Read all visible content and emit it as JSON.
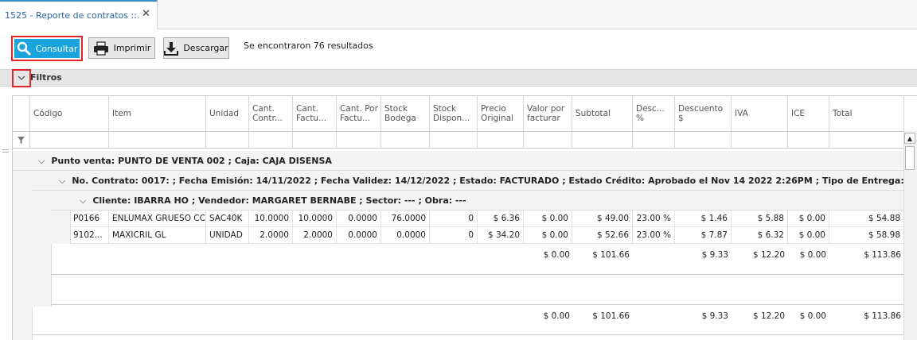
{
  "tab": {
    "title": "1525 - Reporte de contratos ::.",
    "close": "✕"
  },
  "toolbar": {
    "consultar": "Consultar",
    "imprimir": "Imprimir",
    "descargar": "Descargar",
    "results": "Se encontraron 76 resultados",
    "accent": "#1aa3dc",
    "highlight": "#e0252c"
  },
  "filtros": {
    "label": "Filtros"
  },
  "grid": {
    "columns": [
      {
        "label": "Código"
      },
      {
        "label": "Item"
      },
      {
        "label": "Unidad"
      },
      {
        "label": "Cant. Contr..."
      },
      {
        "label": "Cant. Factu..."
      },
      {
        "label": "Cant. Por Factu..."
      },
      {
        "label": "Stock Bodega"
      },
      {
        "label": "Stock Dispon..."
      },
      {
        "label": "Precio Original"
      },
      {
        "label": "Valor por facturar"
      },
      {
        "label": "Subtotal"
      },
      {
        "label": "Desc... %"
      },
      {
        "label": "Descuento $"
      },
      {
        "label": "IVA"
      },
      {
        "label": "ICE"
      },
      {
        "label": "Total"
      }
    ],
    "group1": "Punto venta: PUNTO DE VENTA 002 ; Caja: CAJA DISENSA",
    "group2": "No. Contrato: 0017:       ; Fecha Emisión: 14/11/2022 ; Fecha Validez: 14/12/2022 ; Estado: FACTURADO ; Estado Crédito: Aprobado el Nov 14 2022  2:26PM ; Tipo de Entrega: Retiro en Local",
    "group3": "Cliente: IBARRA HO                              ; Vendedor: MARGARET BERNABE ; Sector: --- ; Obra: ---",
    "rows": [
      [
        "P0166",
        "ENLUMAX GRUESO CC",
        "SAC40K",
        "10.0000",
        "10.0000",
        "0.0000",
        "76.0000",
        "0",
        "$ 6.36",
        "$ 0.00",
        "$ 49.00",
        "23.00 %",
        "$ 1.46",
        "$ 5.88",
        "$ 0.00",
        "$ 54.88"
      ],
      [
        "9102...",
        "MAXICRIL GL",
        "UNIDAD",
        "2.0000",
        "2.0000",
        "0.0000",
        "0.0000",
        "0",
        "$ 34.20",
        "$ 0.00",
        "$ 52.66",
        "23.00 %",
        "$ 7.87",
        "$ 6.32",
        "$ 0.00",
        "$ 58.98"
      ]
    ],
    "subtotals": {
      "valor": "$ 0.00",
      "subtotal": "$ 101.66",
      "descuento": "$ 9.33",
      "iva": "$ 12.20",
      "ice": "$ 0.00",
      "total": "$ 113.86"
    },
    "totals": {
      "valor": "$ 0.00",
      "subtotal": "$ 101.66",
      "descuento": "$ 9.33",
      "iva": "$ 12.20",
      "ice": "$ 0.00",
      "total": "$ 113.86"
    }
  }
}
